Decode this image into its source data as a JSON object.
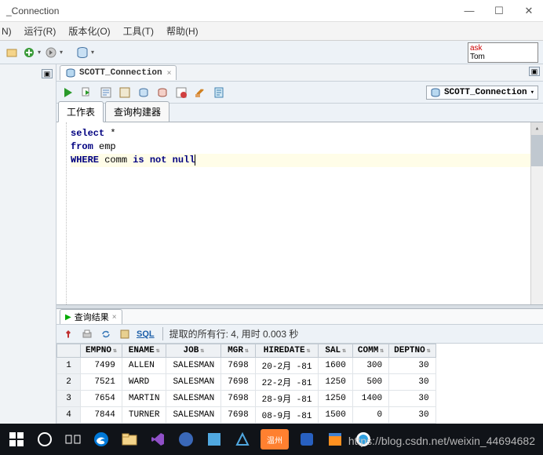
{
  "window": {
    "title": "_Connection"
  },
  "menu": {
    "n": "N)",
    "run": "运行(R)",
    "version": "版本化(O)",
    "tools": "工具(T)",
    "help": "帮助(H)"
  },
  "askbox": {
    "line1": "ask",
    "line2": "Tom"
  },
  "tab": {
    "name": "SCOTT_Connection"
  },
  "connection": {
    "name": "SCOTT_Connection"
  },
  "subtabs": {
    "worksheet": "工作表",
    "builder": "查询构建器"
  },
  "sql": {
    "l1_kw": "select",
    "l1_rest": " *",
    "l2_kw": "from",
    "l2_rest": " emp",
    "l3_kw1": "WHERE",
    "l3_mid": " comm ",
    "l3_kw2": "is not null"
  },
  "results": {
    "tab": "查询结果",
    "sql_link": "SQL",
    "status": "提取的所有行: 4, 用时 0.003 秒",
    "cols": [
      "EMPNO",
      "ENAME",
      "JOB",
      "MGR",
      "HIREDATE",
      "SAL",
      "COMM",
      "DEPTNO"
    ],
    "rows": [
      {
        "n": "1",
        "EMPNO": "7499",
        "ENAME": "ALLEN",
        "JOB": "SALESMAN",
        "MGR": "7698",
        "HIREDATE": "20-2月 -81",
        "SAL": "1600",
        "COMM": "300",
        "DEPTNO": "30"
      },
      {
        "n": "2",
        "EMPNO": "7521",
        "ENAME": "WARD",
        "JOB": "SALESMAN",
        "MGR": "7698",
        "HIREDATE": "22-2月 -81",
        "SAL": "1250",
        "COMM": "500",
        "DEPTNO": "30"
      },
      {
        "n": "3",
        "EMPNO": "7654",
        "ENAME": "MARTIN",
        "JOB": "SALESMAN",
        "MGR": "7698",
        "HIREDATE": "28-9月 -81",
        "SAL": "1250",
        "COMM": "1400",
        "DEPTNO": "30"
      },
      {
        "n": "4",
        "EMPNO": "7844",
        "ENAME": "TURNER",
        "JOB": "SALESMAN",
        "MGR": "7698",
        "HIREDATE": "08-9月 -81",
        "SAL": "1500",
        "COMM": "0",
        "DEPTNO": "30"
      }
    ]
  },
  "watermark": "https://blog.csdn.net/weixin_44694682"
}
